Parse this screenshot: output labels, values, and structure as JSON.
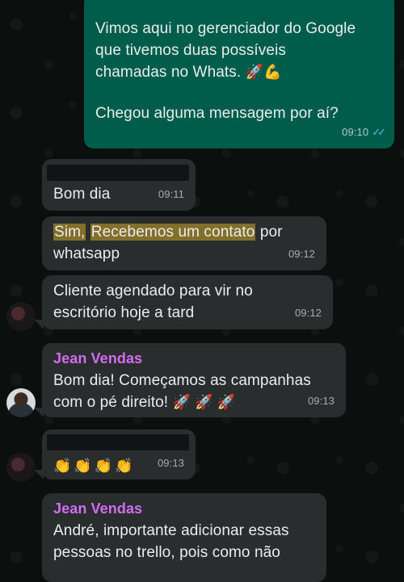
{
  "messages": {
    "m1": {
      "line1": "Vimos aqui no gerenciador do Google",
      "line2": "que tivemos duas possíveis",
      "line3": "chamadas no Whats.",
      "emoji": "🚀💪",
      "line4": "Chegou alguma mensagem por aí?",
      "time": "09:10",
      "status": "✓✓"
    },
    "m2": {
      "text": "Bom dia",
      "time": "09:11"
    },
    "m3": {
      "highlight1": "Sim,",
      "highlight2": "Recebemos um contato",
      "rest": " por",
      "line2": "whatsapp",
      "time": "09:12"
    },
    "m4": {
      "line1": "Cliente agendado para vir no",
      "line2": "escritório hoje a tard",
      "time": "09:12"
    },
    "m5": {
      "sender": "Jean Vendas",
      "line1": "Bom dia! Começamos as campanhas",
      "line2": "com o pé direito!",
      "emoji": "🚀 🚀 🚀",
      "time": "09:13"
    },
    "m6": {
      "emoji": "👏👏👏👏",
      "time": "09:13"
    },
    "m7": {
      "sender": "Jean Vendas",
      "line1": "André, importante adicionar essas",
      "line2": "pessoas no trello, pois como não"
    }
  },
  "icons": {
    "sent_ticks": "double-check-icon",
    "avatar_dark": "contact-avatar-dark",
    "avatar_photo": "contact-avatar-photo"
  },
  "colors": {
    "outgoing_bubble": "#005c4b",
    "incoming_bubble": "#2a2d2e",
    "sender_name": "#d36cf0",
    "read_ticks": "#53bdeb",
    "highlight": "#c8a528"
  }
}
